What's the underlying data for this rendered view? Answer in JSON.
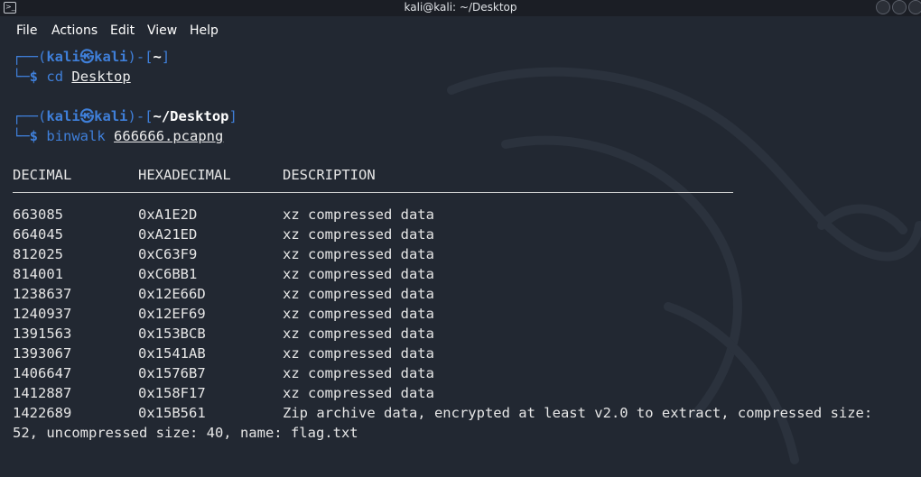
{
  "window": {
    "title": "kali@kali: ~/Desktop"
  },
  "menu": [
    "File",
    "Actions",
    "Edit",
    "View",
    "Help"
  ],
  "prompts": [
    {
      "open": "┌──(",
      "user": "kali",
      "at": "㉿",
      "host": "kali",
      "mid": ")-[",
      "path": "~",
      "close": "]",
      "arrow": "└─",
      "dollar": "$",
      "command": "cd",
      "argument": "Desktop"
    },
    {
      "open": "┌──(",
      "user": "kali",
      "at": "㉿",
      "host": "kali",
      "mid": ")-[",
      "path": "~/Desktop",
      "close": "]",
      "arrow": "└─",
      "dollar": "$",
      "command": "binwalk",
      "argument": "666666.pcapng"
    }
  ],
  "output": {
    "headers": [
      "DECIMAL",
      "HEXADECIMAL",
      "DESCRIPTION"
    ],
    "rows": [
      [
        "663085",
        "0xA1E2D",
        "xz compressed data"
      ],
      [
        "664045",
        "0xA21ED",
        "xz compressed data"
      ],
      [
        "812025",
        "0xC63F9",
        "xz compressed data"
      ],
      [
        "814001",
        "0xC6BB1",
        "xz compressed data"
      ],
      [
        "1238637",
        "0x12E66D",
        "xz compressed data"
      ],
      [
        "1240937",
        "0x12EF69",
        "xz compressed data"
      ],
      [
        "1391563",
        "0x153BCB",
        "xz compressed data"
      ],
      [
        "1393067",
        "0x1541AB",
        "xz compressed data"
      ],
      [
        "1406647",
        "0x1576B7",
        "xz compressed data"
      ],
      [
        "1412887",
        "0x158F17",
        "xz compressed data"
      ],
      [
        "1422689",
        "0x15B561",
        "Zip archive data, encrypted at least v2.0 to extract, compressed size:"
      ]
    ],
    "wrap_line": "52, uncompressed size: 40, name: flag.txt"
  },
  "colors": {
    "background": "#222832",
    "prompt_blue": "#3f7fd9",
    "text": "#e6e6e6"
  }
}
